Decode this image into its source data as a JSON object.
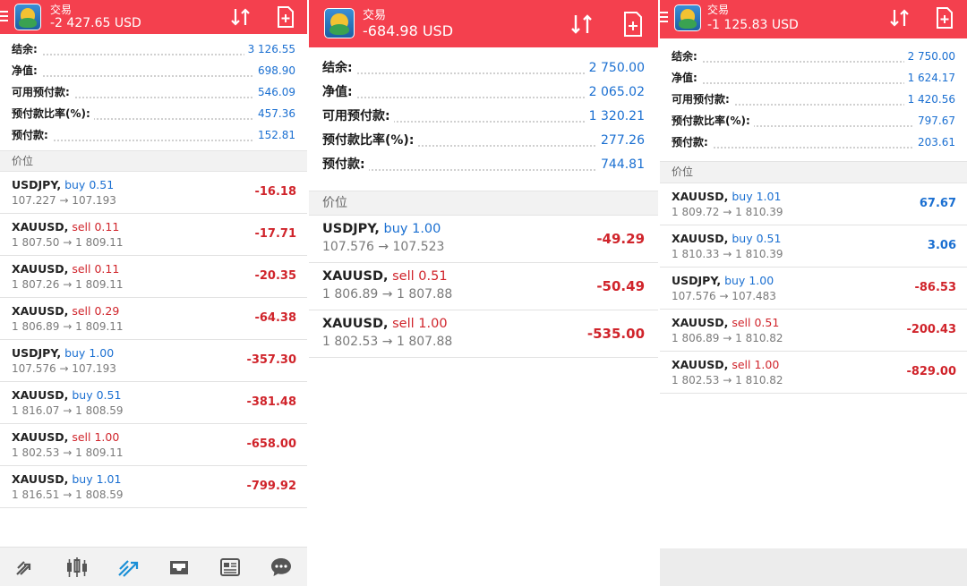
{
  "panels": [
    {
      "header": {
        "title": "交易",
        "balance": "-2 427.65 USD"
      },
      "summary": [
        {
          "label": "结余:",
          "value": "3 126.55"
        },
        {
          "label": "净值:",
          "value": "698.90"
        },
        {
          "label": "可用预付款:",
          "value": "546.09"
        },
        {
          "label": "预付款比率(%):",
          "value": "457.36"
        },
        {
          "label": "预付款:",
          "value": "152.81"
        }
      ],
      "section_label": "价位",
      "trades": [
        {
          "symbol": "USDJPY,",
          "side": "buy",
          "volume": "0.51",
          "prices": "107.227 → 107.193",
          "profit": "-16.18"
        },
        {
          "symbol": "XAUUSD,",
          "side": "sell",
          "volume": "0.11",
          "prices": "1 807.50 → 1 809.11",
          "profit": "-17.71"
        },
        {
          "symbol": "XAUUSD,",
          "side": "sell",
          "volume": "0.11",
          "prices": "1 807.26 → 1 809.11",
          "profit": "-20.35"
        },
        {
          "symbol": "XAUUSD,",
          "side": "sell",
          "volume": "0.29",
          "prices": "1 806.89 → 1 809.11",
          "profit": "-64.38"
        },
        {
          "symbol": "USDJPY,",
          "side": "buy",
          "volume": "1.00",
          "prices": "107.576 → 107.193",
          "profit": "-357.30"
        },
        {
          "symbol": "XAUUSD,",
          "side": "buy",
          "volume": "0.51",
          "prices": "1 816.07 → 1 808.59",
          "profit": "-381.48"
        },
        {
          "symbol": "XAUUSD,",
          "side": "sell",
          "volume": "1.00",
          "prices": "1 802.53 → 1 809.11",
          "profit": "-658.00"
        },
        {
          "symbol": "XAUUSD,",
          "side": "buy",
          "volume": "1.01",
          "prices": "1 816.51 → 1 808.59",
          "profit": "-799.92"
        }
      ],
      "bottom_nav": [
        "quotes-icon",
        "chart-candles-icon",
        "trade-icon",
        "history-icon",
        "news-icon",
        "chat-icon"
      ]
    },
    {
      "header": {
        "title": "交易",
        "balance": "-684.98 USD"
      },
      "summary": [
        {
          "label": "结余:",
          "value": "2 750.00"
        },
        {
          "label": "净值:",
          "value": "2 065.02"
        },
        {
          "label": "可用预付款:",
          "value": "1 320.21"
        },
        {
          "label": "预付款比率(%):",
          "value": "277.26"
        },
        {
          "label": "预付款:",
          "value": "744.81"
        }
      ],
      "section_label": "价位",
      "trades": [
        {
          "symbol": "USDJPY,",
          "side": "buy",
          "volume": "1.00",
          "prices": "107.576 → 107.523",
          "profit": "-49.29"
        },
        {
          "symbol": "XAUUSD,",
          "side": "sell",
          "volume": "0.51",
          "prices": "1 806.89 → 1 807.88",
          "profit": "-50.49"
        },
        {
          "symbol": "XAUUSD,",
          "side": "sell",
          "volume": "1.00",
          "prices": "1 802.53 → 1 807.88",
          "profit": "-535.00"
        }
      ]
    },
    {
      "header": {
        "title": "交易",
        "balance": "-1 125.83 USD"
      },
      "summary": [
        {
          "label": "结余:",
          "value": "2 750.00"
        },
        {
          "label": "净值:",
          "value": "1 624.17"
        },
        {
          "label": "可用预付款:",
          "value": "1 420.56"
        },
        {
          "label": "预付款比率(%):",
          "value": "797.67"
        },
        {
          "label": "预付款:",
          "value": "203.61"
        }
      ],
      "section_label": "价位",
      "trades": [
        {
          "symbol": "XAUUSD,",
          "side": "buy",
          "volume": "1.01",
          "prices": "1 809.72 → 1 810.39",
          "profit": "67.67"
        },
        {
          "symbol": "XAUUSD,",
          "side": "buy",
          "volume": "0.51",
          "prices": "1 810.33 → 1 810.39",
          "profit": "3.06"
        },
        {
          "symbol": "USDJPY,",
          "side": "buy",
          "volume": "1.00",
          "prices": "107.576 → 107.483",
          "profit": "-86.53"
        },
        {
          "symbol": "XAUUSD,",
          "side": "sell",
          "volume": "0.51",
          "prices": "1 806.89 → 1 810.82",
          "profit": "-200.43"
        },
        {
          "symbol": "XAUUSD,",
          "side": "sell",
          "volume": "1.00",
          "prices": "1 802.53 → 1 810.82",
          "profit": "-829.00"
        }
      ]
    }
  ],
  "colors": {
    "header": "#f4404e",
    "positive": "#1a6fd1",
    "negative": "#d0242b"
  }
}
